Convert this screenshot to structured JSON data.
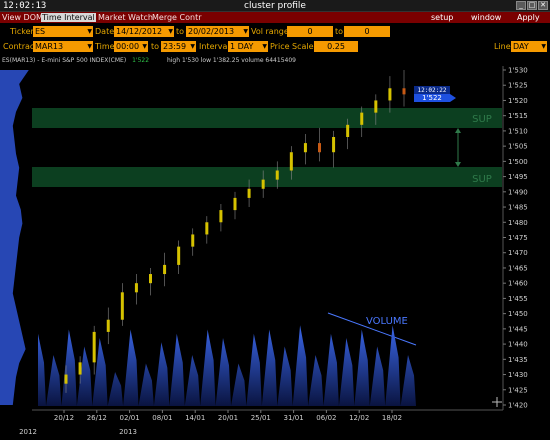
{
  "window": {
    "clock": "12:02:13",
    "title": "cluster profile",
    "buttons": {
      "minimize": "_",
      "maximize": "□",
      "close": "✕"
    }
  },
  "menu": {
    "items": [
      "View DOM",
      "Time Interval",
      "Market Watch",
      "Merge Contr"
    ],
    "active_index": 1,
    "right_items": [
      "setup",
      "window",
      "Apply"
    ]
  },
  "toolbar": {
    "ticker_label": "Ticker",
    "ticker_value": "ES",
    "date_label": "Date",
    "date_from": "14/12/2012",
    "date_to_label": "to",
    "date_to": "20/02/2013",
    "vol_range_label": "Vol range",
    "vol_from": "0",
    "vol_to_label": "to",
    "vol_to": "0",
    "contract_label": "Contract",
    "contract_value": "MAR13",
    "time_label": "Time",
    "time_from": "00:00",
    "time_to_label": "to",
    "time_to": "23:59",
    "interval_label": "Interval",
    "interval_value": "1 DAY",
    "price_scale_label": "Price Scale",
    "price_scale_value": "0.25",
    "line_label": "Line",
    "line_value": "DAY"
  },
  "chart_header": {
    "symbol": "ES(MAR13) - E-mini S&P 500 INDEX(CME)",
    "price": "1'522",
    "stats": "high 1'530  low 1'382.25  volume 64415409"
  },
  "tooltip": {
    "time": "12:02:22",
    "price": "1'522"
  },
  "annotations": {
    "sup_upper": "SUP",
    "sup_lower": "SUP",
    "volume": "VOLUME"
  },
  "colors": {
    "menubar": "#7a0000",
    "field": "#f59a00",
    "label": "#e6a800",
    "profile": "#2b4fc8",
    "support_band": "#0e4a26",
    "volume": "#2844b0",
    "candle_up": "#d6c200",
    "candle_down": "#c85a14"
  },
  "chart_data": {
    "type": "candlestick",
    "y_ticks": [
      "1'530",
      "1'525",
      "1'520",
      "1'515",
      "1'510",
      "1'505",
      "1'500",
      "1'495",
      "1'490",
      "1'485",
      "1'480",
      "1'475",
      "1'470",
      "1'465",
      "1'460",
      "1'455",
      "1'450",
      "1'445",
      "1'440",
      "1'435",
      "1'430",
      "1'425",
      "1'420"
    ],
    "ylim": [
      1420,
      1530
    ],
    "x_ticks": [
      "20/12",
      "26/12",
      "02/01",
      "08/01",
      "14/01",
      "20/01",
      "25/01",
      "31/01",
      "06/02",
      "12/02",
      "18/02"
    ],
    "x_years": [
      "2012",
      "2013"
    ],
    "candles": [
      {
        "o": 1427,
        "h": 1433,
        "l": 1424,
        "c": 1430
      },
      {
        "o": 1430,
        "h": 1436,
        "l": 1427,
        "c": 1434
      },
      {
        "o": 1434,
        "h": 1446,
        "l": 1430,
        "c": 1444
      },
      {
        "o": 1444,
        "h": 1452,
        "l": 1440,
        "c": 1448
      },
      {
        "o": 1448,
        "h": 1460,
        "l": 1446,
        "c": 1457
      },
      {
        "o": 1457,
        "h": 1463,
        "l": 1453,
        "c": 1460
      },
      {
        "o": 1460,
        "h": 1465,
        "l": 1456,
        "c": 1463
      },
      {
        "o": 1463,
        "h": 1470,
        "l": 1459,
        "c": 1466
      },
      {
        "o": 1466,
        "h": 1474,
        "l": 1463,
        "c": 1472
      },
      {
        "o": 1472,
        "h": 1478,
        "l": 1469,
        "c": 1476
      },
      {
        "o": 1476,
        "h": 1482,
        "l": 1473,
        "c": 1480
      },
      {
        "o": 1480,
        "h": 1486,
        "l": 1477,
        "c": 1484
      },
      {
        "o": 1484,
        "h": 1490,
        "l": 1481,
        "c": 1488
      },
      {
        "o": 1488,
        "h": 1494,
        "l": 1485,
        "c": 1491
      },
      {
        "o": 1491,
        "h": 1497,
        "l": 1488,
        "c": 1494
      },
      {
        "o": 1494,
        "h": 1500,
        "l": 1491,
        "c": 1497
      },
      {
        "o": 1497,
        "h": 1505,
        "l": 1494,
        "c": 1503
      },
      {
        "o": 1503,
        "h": 1509,
        "l": 1499,
        "c": 1506
      },
      {
        "o": 1506,
        "h": 1511,
        "l": 1500,
        "c": 1503
      },
      {
        "o": 1503,
        "h": 1510,
        "l": 1498,
        "c": 1508
      },
      {
        "o": 1508,
        "h": 1514,
        "l": 1504,
        "c": 1512
      },
      {
        "o": 1512,
        "h": 1518,
        "l": 1508,
        "c": 1516
      },
      {
        "o": 1516,
        "h": 1522,
        "l": 1512,
        "c": 1520
      },
      {
        "o": 1520,
        "h": 1528,
        "l": 1516,
        "c": 1524
      },
      {
        "o": 1524,
        "h": 1530,
        "l": 1518,
        "c": 1522
      }
    ],
    "volume_profile_relative": [
      0.9,
      0.6,
      0.7,
      0.5,
      0.4,
      0.45,
      0.5,
      0.6,
      0.55,
      0.5,
      0.65,
      0.7,
      0.6,
      0.55,
      0.5,
      0.45,
      0.4,
      0.5,
      0.6,
      0.7,
      0.8,
      0.6,
      0.5,
      0.45,
      0.4
    ],
    "volume_relative": [
      0.85,
      0.6,
      0.9,
      0.7,
      0.8,
      0.4,
      0.9,
      0.5,
      0.75,
      0.85,
      0.6,
      0.9,
      0.8,
      0.5,
      0.85,
      0.9,
      0.7,
      0.95,
      0.6,
      0.85,
      0.8,
      0.9,
      0.7,
      0.95,
      0.6
    ]
  }
}
